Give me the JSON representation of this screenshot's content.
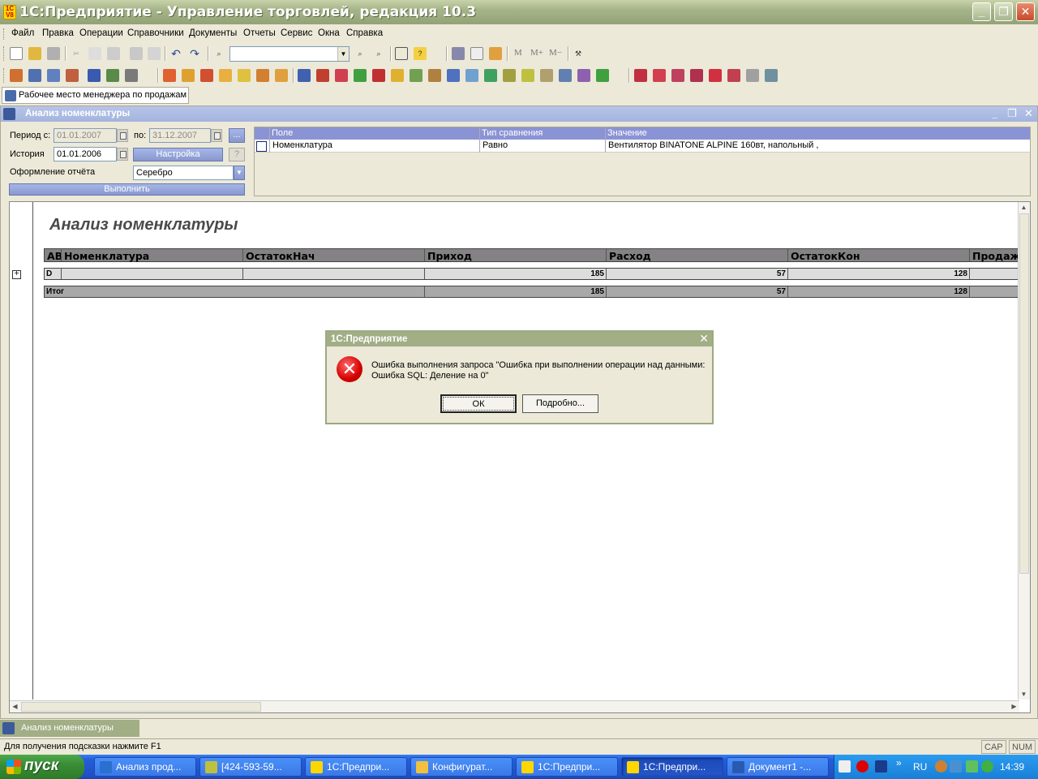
{
  "window": {
    "title": "1С:Предприятие - Управление торговлей, редакция 10.3",
    "app_icon_text": "1С V8"
  },
  "menu": [
    "Файл",
    "Правка",
    "Операции",
    "Справочники",
    "Документы",
    "Отчеты",
    "Сервис",
    "Окна",
    "Справка"
  ],
  "toolbar": {
    "memory_labels": [
      "M",
      "M+",
      "M−"
    ]
  },
  "workplace_tab": "Рабочее место менеджера по продажам",
  "child": {
    "title": "Анализ номенклатуры",
    "form": {
      "period_from_label": "Период с:",
      "period_from_value": "01.01.2007",
      "period_to_label": "по:",
      "period_to_value": "31.12.2007",
      "more_button": "...",
      "history_label": "История",
      "history_value": "01.01.2006",
      "settings_button": "Настройка",
      "help_button": "?",
      "design_label": "Оформление отчёта",
      "design_value": "Серебро",
      "run_button": "Выполнить"
    },
    "filter": {
      "headers": [
        "Поле",
        "Тип сравнения",
        "Значение"
      ],
      "row": {
        "field": "Номенклатура",
        "comparison": "Равно",
        "value": "Вентилятор BINATONE ALPINE 160вт, напольный ,"
      }
    },
    "report": {
      "title": "Анализ номенклатуры",
      "headers": [
        "АВ",
        "Номенклатура",
        "ОстатокНач",
        "Приход",
        "Расход",
        "ОстатокКон",
        "Продажи"
      ],
      "group_row": {
        "ab": "D",
        "nomenclature": "",
        "start_balance": "",
        "income": "185",
        "expense": "57",
        "end_balance": "128"
      },
      "total_row": {
        "ab": "Итог",
        "nomenclature": "",
        "start_balance": "",
        "income": "185",
        "expense": "57",
        "end_balance": "128"
      }
    }
  },
  "dialog": {
    "title": "1С:Предприятие",
    "message_line1": "Ошибка выполнения запроса \"Ошибка при выполнении операции над данными:",
    "message_line2": "Ошибка SQL: Деление на 0\"",
    "ok_button": "ОК",
    "details_button": "Подробно..."
  },
  "window_tab": "Анализ номенклатуры",
  "status": {
    "hint": "Для получения подсказки нажмите F1",
    "cap": "CAP",
    "num": "NUM"
  },
  "taskbar": {
    "start": "пуск",
    "buttons": [
      "Анализ прод...",
      "[424-593-59...",
      "1С:Предпри...",
      "Конфигурат...",
      "1С:Предпри...",
      "1С:Предпри...",
      "Документ1 -..."
    ],
    "lang": "RU",
    "clock": "14:39"
  },
  "colors": {
    "title_bar": "#a6b48a",
    "child_title": "#a4b4de",
    "header_blue": "#8a94d4",
    "error_red": "#d40000",
    "taskbar_blue": "#245edb"
  }
}
